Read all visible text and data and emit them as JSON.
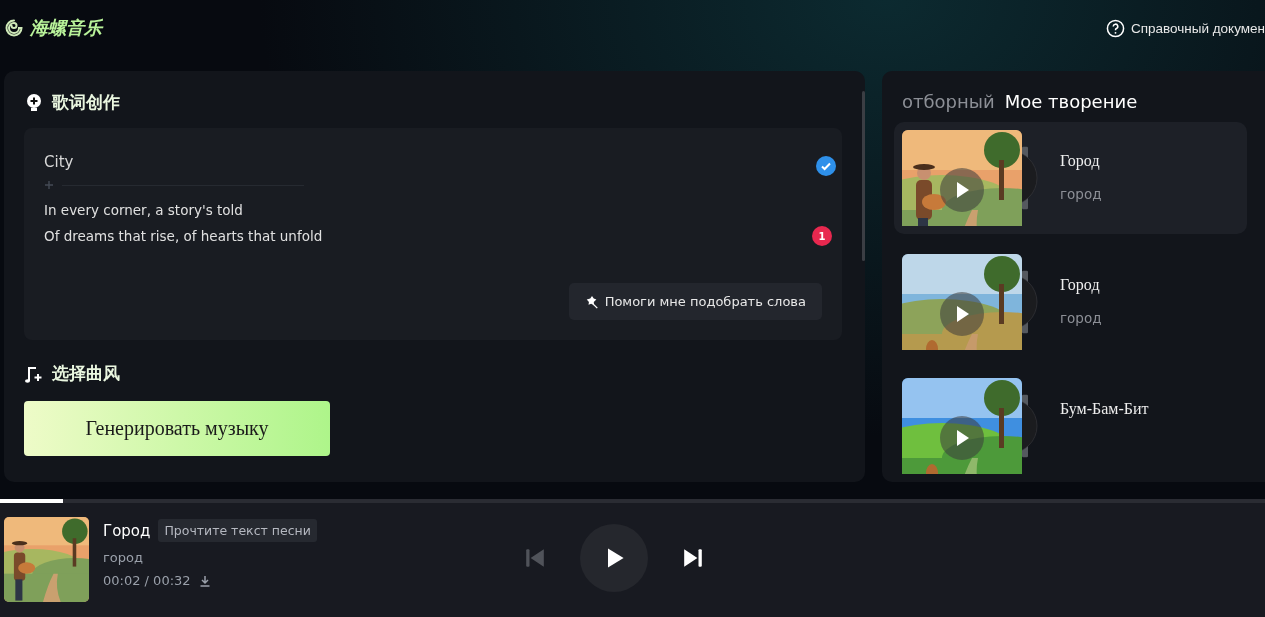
{
  "app": {
    "logo": "海螺音乐",
    "help_link": "Справочный докумен"
  },
  "lyrics": {
    "heading": "歌词创作",
    "title": "City",
    "title_checked": true,
    "lines": [
      "In every corner, a story's told",
      "Of dreams that rise, of hearts that unfold"
    ],
    "badge": "1",
    "assist_button": "Помоги мне подобрать слова"
  },
  "style_section": {
    "heading": "选择曲风"
  },
  "generate_button": "Генерировать музыку",
  "tabs": [
    {
      "label": "отборный",
      "selected": false
    },
    {
      "label": "Мое творение",
      "selected": true
    }
  ],
  "songs": [
    {
      "title": "Город",
      "subtitle": "город",
      "selected": true,
      "kind": "picture"
    },
    {
      "title": "Город",
      "subtitle": "город",
      "selected": false,
      "kind": "picture"
    },
    {
      "title": "Бум-Бам-Бит",
      "selected": false,
      "kind": "picture"
    }
  ],
  "player": {
    "title": "Город",
    "lyrics_button": "Прочтите текст песни",
    "artist": "город",
    "time": "00:02 / 00:32",
    "level": 0.05,
    "prev_disabled": true
  }
}
